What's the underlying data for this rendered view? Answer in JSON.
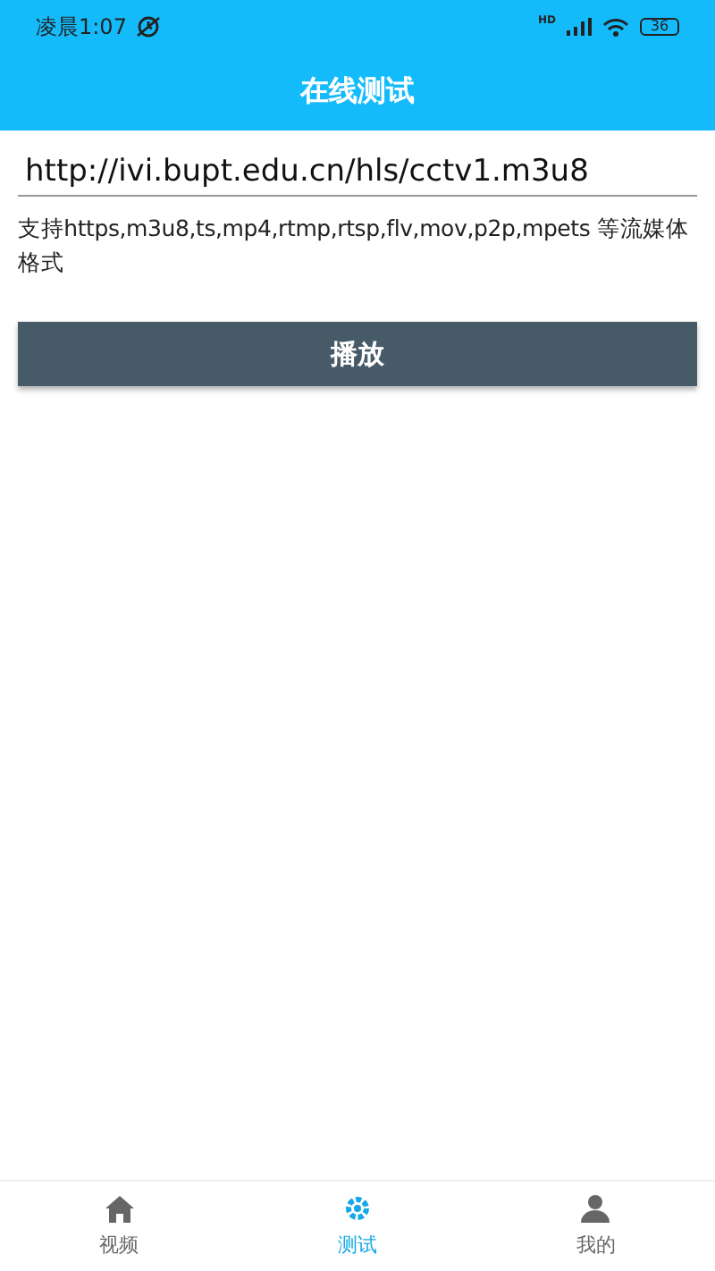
{
  "status_bar": {
    "time": "凌晨1:07",
    "network": "HD",
    "battery": "36"
  },
  "title_bar": {
    "title": "在线测试"
  },
  "url_field": {
    "value": "http://ivi.bupt.edu.cn/hls/cctv1.m3u8"
  },
  "hint": "支持https,m3u8,ts,mp4,rtmp,rtsp,flv,mov,p2p,mpets 等流媒体格式",
  "play_button": {
    "label": "播放"
  },
  "bottom_nav": [
    {
      "kind": "home",
      "label": "视频",
      "selected": false
    },
    {
      "kind": "test",
      "label": "测试",
      "selected": true
    },
    {
      "kind": "user",
      "label": "我的",
      "selected": false
    }
  ]
}
